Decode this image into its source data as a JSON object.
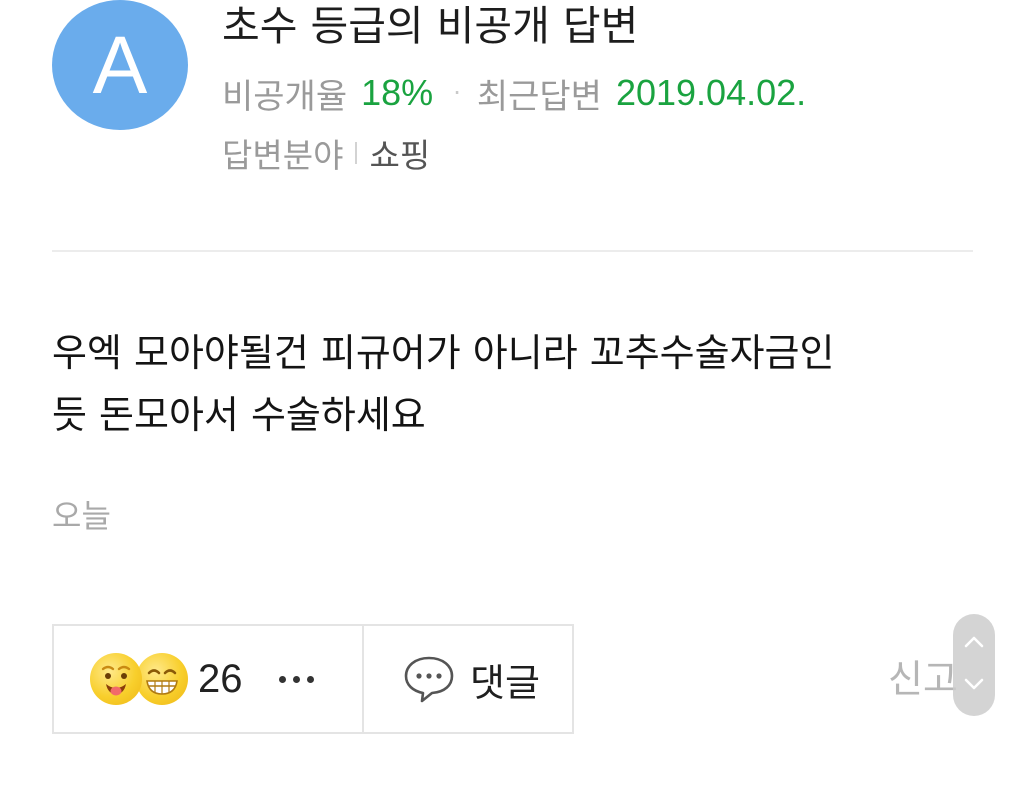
{
  "answerer": {
    "avatar_letter": "A",
    "title": "초수 등급의 비공개 답변",
    "private_rate_label": "비공개율",
    "private_rate_value": "18%",
    "stat_separator": "·",
    "recent_answer_label": "최근답변",
    "recent_answer_date": "2019.04.02.",
    "field_label": "답변분야",
    "field_value": "쇼핑"
  },
  "answer": {
    "text": "우엑 모아야될건 피규어가 아니라 꼬추수술자금인\n듯 돈모아서 수술하세요",
    "timestamp": "오늘"
  },
  "actions": {
    "reaction_count": "26",
    "comment_label": "댓글",
    "report_label": "신고"
  },
  "icons": {
    "avatar": "letter-avatar",
    "reaction_1": "tongue-out-emoji-icon",
    "reaction_2": "grinning-emoji-icon",
    "more": "more-dots-icon",
    "comment": "speech-bubble-icon",
    "scroll_up": "chevron-up-icon",
    "scroll_down": "chevron-down-icon"
  },
  "colors": {
    "avatar": "#6aacec",
    "highlight_green": "#1aa340",
    "muted_text": "#9a9a9a",
    "emoji_yellow": "#f8cf2c"
  }
}
